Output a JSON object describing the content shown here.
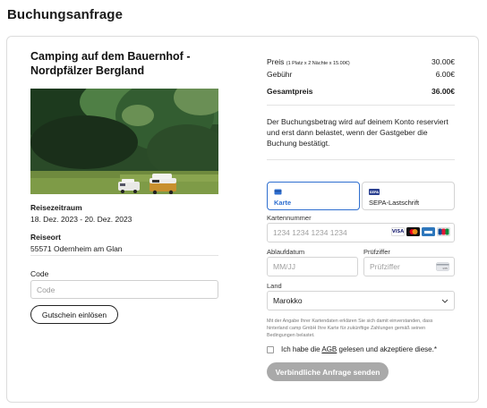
{
  "page": {
    "title": "Buchungsanfrage"
  },
  "listing": {
    "title": "Camping auf dem Bauernhof - Nordpfälzer Bergland",
    "travel_period_label": "Reisezeitraum",
    "travel_period_value": "18. Dez. 2023 - 20. Dez. 2023",
    "location_label": "Reiseort",
    "location_value": "55571 Odernheim am Glan"
  },
  "voucher": {
    "code_label": "Code",
    "code_placeholder": "Code",
    "button_label": "Gutschein einlösen"
  },
  "pricing": {
    "price_label": "Preis",
    "price_detail": "(1 Platz x 2 Nächte x 15.00€)",
    "price_value": "30.00€",
    "fee_label": "Gebühr",
    "fee_value": "6.00€",
    "total_label": "Gesamtpreis",
    "total_value": "36.00€"
  },
  "info_text": "Der Buchungsbetrag wird auf deinem Konto reserviert und erst dann belastet, wenn der Gastgeber die Buchung bestätigt.",
  "payment": {
    "tabs": [
      {
        "label": "Karte",
        "icon": "credit-card-icon",
        "active": true
      },
      {
        "label": "SEPA-Lastschrift",
        "icon": "bank-icon",
        "active": false
      }
    ],
    "sepa_icon_text": "SEPA",
    "card_number_label": "Kartennummer",
    "card_number_placeholder": "1234 1234 1234 1234",
    "card_brands": [
      {
        "name": "VISA",
        "color": "#1a1f71"
      },
      {
        "name": "",
        "color": "#eb001b"
      },
      {
        "name": "",
        "color": "#2e77bc"
      },
      {
        "name": "JCB",
        "color": "#0b8a3c"
      }
    ],
    "expiry_label": "Ablaufdatum",
    "expiry_placeholder": "MM/JJ",
    "cvc_label": "Prüfziffer",
    "cvc_placeholder": "Prüfziffer",
    "cvc_badge": "135",
    "country_label": "Land",
    "country_value": "Marokko",
    "disclaimer": "Mit der Angabe Ihrer Kartendaten erklären Sie sich damit einverstanden, dass hinterland camp GmbH Ihre Karte für zukünftige Zahlungen gemäß seinen Bedingungen belastet."
  },
  "agreement": {
    "prefix": "Ich habe die",
    "link": "AGB",
    "suffix": "gelesen und akzeptiere diese.*"
  },
  "submit_label": "Verbindliche Anfrage senden",
  "colors": {
    "accent": "#2f6fd0",
    "submit_disabled": "#a9a9a9"
  }
}
